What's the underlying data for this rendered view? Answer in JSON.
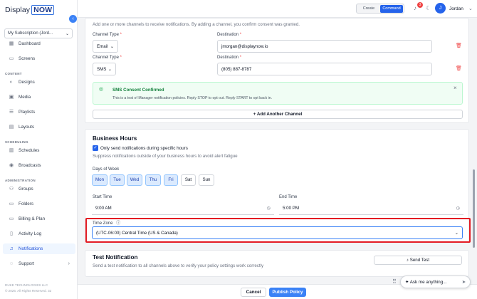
{
  "brand": {
    "name_part1": "Display",
    "name_part2": "NOW"
  },
  "sidebar": {
    "subscription": "My Subscription (Jord...",
    "sections": {
      "content": "CONTENT",
      "scheduling": "SCHEDULING",
      "administration": "ADMINISTRATION"
    },
    "items": [
      {
        "label": "Dashboard",
        "icon": "grid-icon"
      },
      {
        "label": "Screens",
        "icon": "monitor-icon"
      },
      {
        "label": "Designs",
        "icon": "palette-icon"
      },
      {
        "label": "Media",
        "icon": "image-icon"
      },
      {
        "label": "Playlists",
        "icon": "list-icon"
      },
      {
        "label": "Layouts",
        "icon": "layout-icon"
      },
      {
        "label": "Schedules",
        "icon": "calendar-icon"
      },
      {
        "label": "Broadcasts",
        "icon": "broadcast-icon"
      },
      {
        "label": "Groups",
        "icon": "users-icon"
      },
      {
        "label": "Folders",
        "icon": "folder-icon"
      },
      {
        "label": "Billing & Plan",
        "icon": "card-icon"
      },
      {
        "label": "Activity Log",
        "icon": "doc-icon"
      },
      {
        "label": "Notifications",
        "icon": "bell-icon",
        "active": true
      },
      {
        "label": "Support",
        "icon": "help-icon"
      }
    ],
    "footer_line1": "DUKE TECHNOLOGIES LLC",
    "footer_line2": "© 2026. All Rights Reserved. 32"
  },
  "topbar": {
    "mode_create": "Create",
    "mode_command": "Command",
    "notification_count": "3",
    "avatar_initial": "J",
    "user_name": "Jordan"
  },
  "channels": {
    "intro": "Add one or more channels to receive notifications. By adding a channel, you confirm consent was granted.",
    "type_label": "Channel Type",
    "destination_label": "Destination",
    "required_mark": "*",
    "rows": [
      {
        "type": "Email",
        "destination": "jmorgan@displaynow.io"
      },
      {
        "type": "SMS",
        "destination": "(805) 887-8787"
      }
    ],
    "sms_title": "SMS Consent Confirmed",
    "sms_body": "This is a test of Manager notification policies. Reply STOP to opt out. Reply START to opt back in.",
    "add_label": "+ Add Another Channel"
  },
  "business_hours": {
    "title": "Business Hours",
    "checkbox_label": "Only send notifications during specific hours",
    "help": "Suppress notifications outside of your business hours to avoid alert fatigue",
    "days_label": "Days of Week",
    "days": [
      {
        "label": "Mon",
        "on": true
      },
      {
        "label": "Tue",
        "on": true
      },
      {
        "label": "Wed",
        "on": true
      },
      {
        "label": "Thu",
        "on": true
      },
      {
        "label": "Fri",
        "on": true
      },
      {
        "label": "Sat",
        "on": false
      },
      {
        "label": "Sun",
        "on": false
      }
    ],
    "start_label": "Start Time",
    "start_value": "9:00 AM",
    "end_label": "End Time",
    "end_value": "5:00 PM",
    "timezone_label": "Time Zone",
    "timezone_value": "(UTC-06:00) Central Time (US & Canada)"
  },
  "test_notification": {
    "title": "Test Notification",
    "body": "Send a test notification to all channels above to verify your policy settings work correctly",
    "button": "Send Test"
  },
  "footer_actions": {
    "cancel": "Cancel",
    "publish": "Publish Policy"
  },
  "assistant": {
    "placeholder": "Ask me anything..."
  },
  "colors": {
    "accent": "#3b82f6",
    "highlight_frame": "#e31b23",
    "danger": "#ef4444"
  }
}
